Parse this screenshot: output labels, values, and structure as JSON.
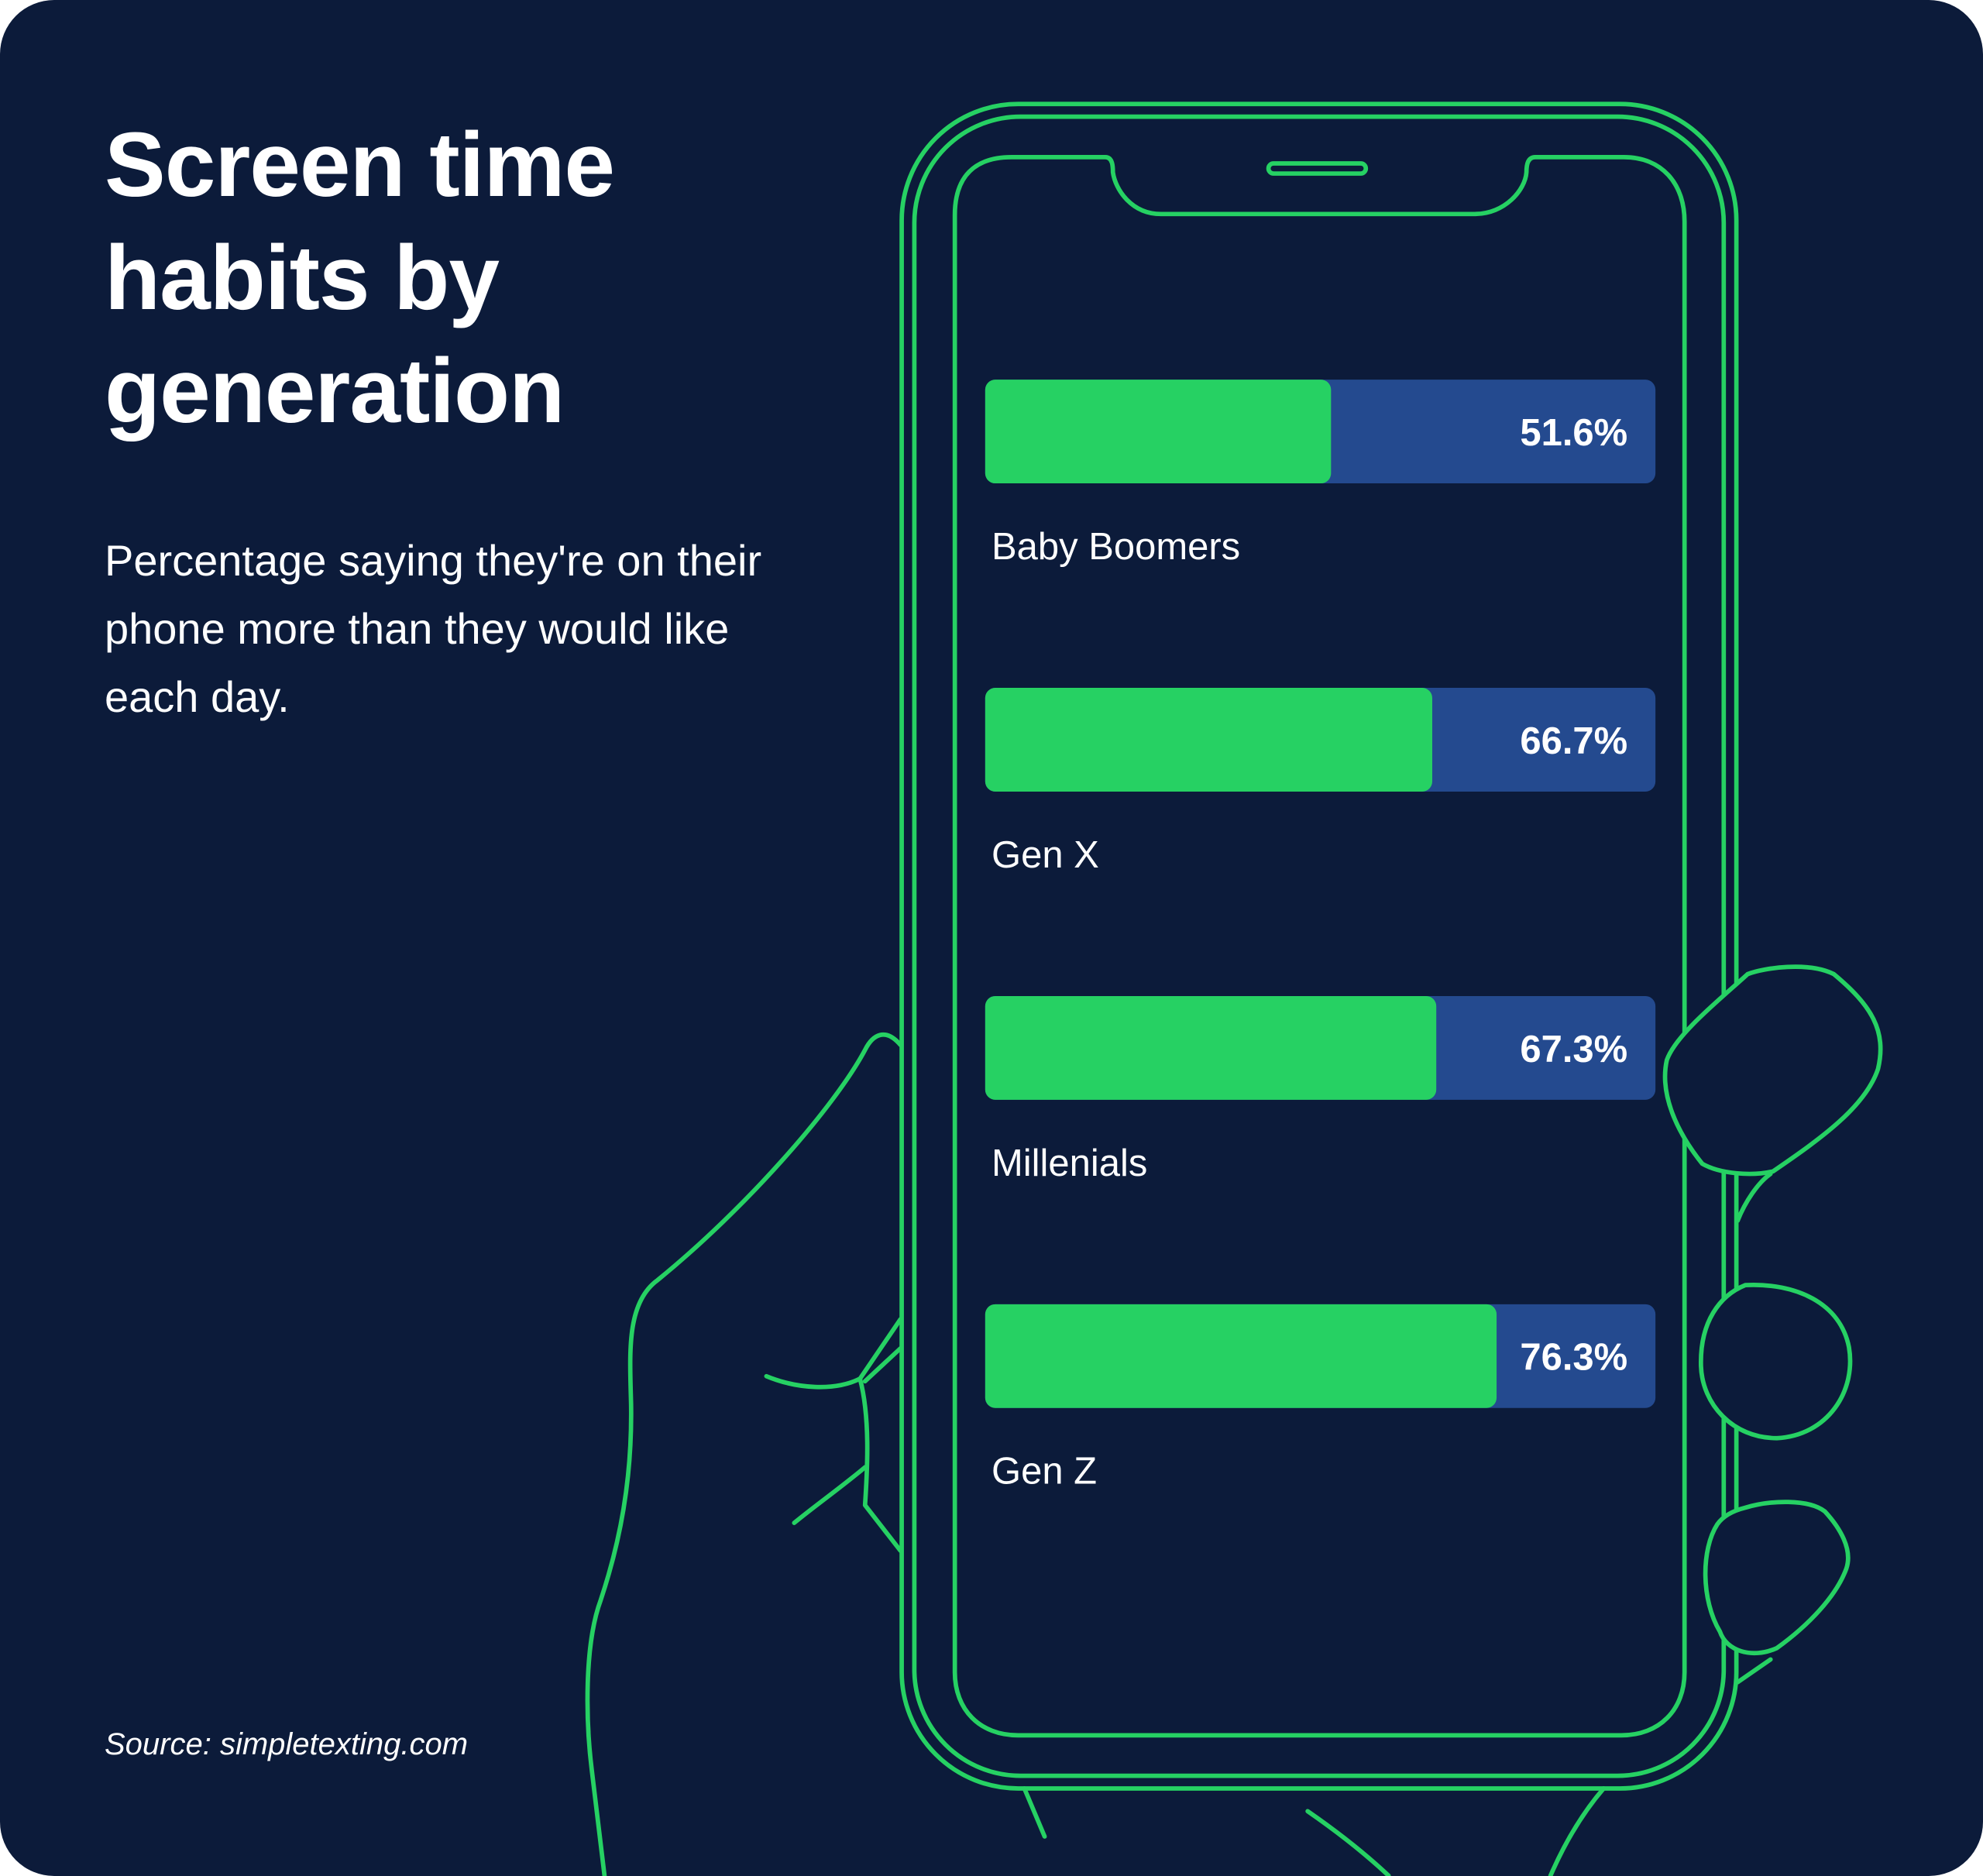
{
  "header": {
    "title_lines": [
      "Screen time",
      "habits by",
      "generation"
    ],
    "subtitle": "Percentage saying they're on their phone more than they would like each day."
  },
  "footer": {
    "source": "Source: simpletexting.com"
  },
  "colors": {
    "background": "#0c1b3a",
    "accent_green": "#26d163",
    "track_blue": "#244a8f",
    "text": "#ffffff"
  },
  "chart_data": {
    "type": "bar",
    "orientation": "horizontal",
    "title": "Screen time habits by generation",
    "subtitle": "Percentage saying they're on their phone more than they would like each day.",
    "categories": [
      "Baby Boomers",
      "Gen X",
      "Millenials",
      "Gen Z"
    ],
    "values": [
      51.6,
      66.7,
      67.3,
      76.3
    ],
    "value_labels": [
      "51.6%",
      "66.7%",
      "67.3%",
      "76.3%"
    ],
    "unit": "%",
    "xlim": [
      0,
      100
    ],
    "xlabel": "",
    "ylabel": "",
    "grid": false,
    "legend": "none",
    "source": "Source: simpletexting.com"
  }
}
